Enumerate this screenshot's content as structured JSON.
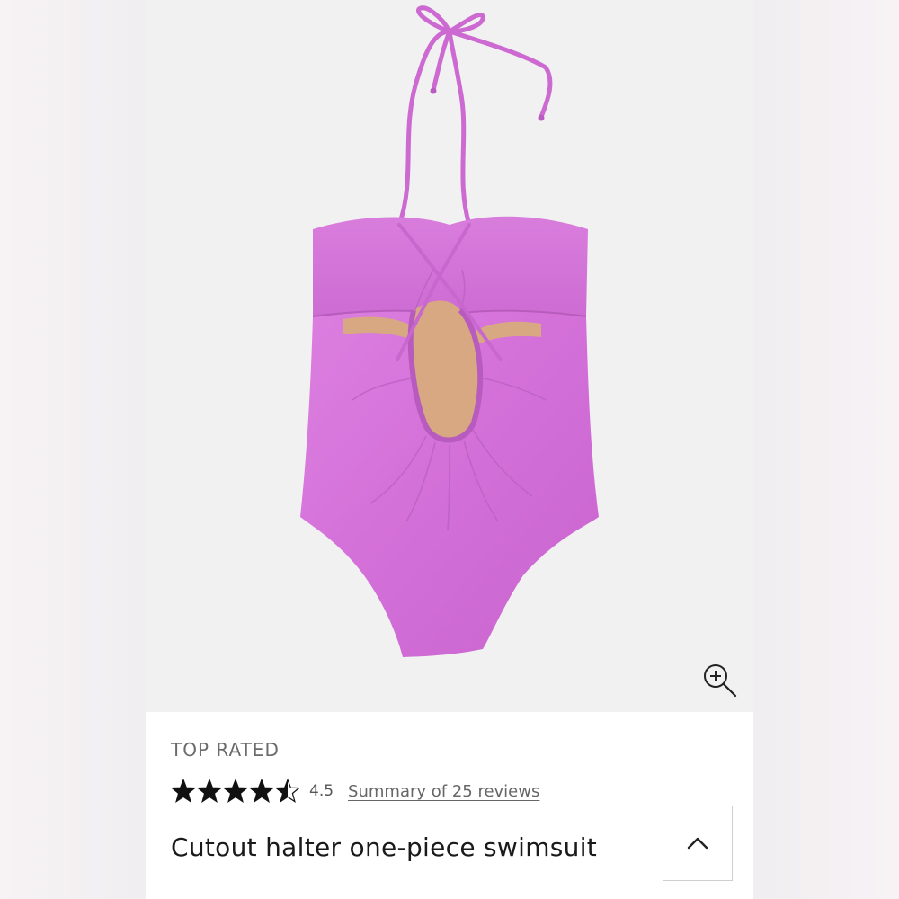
{
  "product": {
    "badge": "TOP RATED",
    "rating_value": "4.5",
    "rating_stars": 4.5,
    "rating_max": 5,
    "reviews_link": "Summary of 25 reviews",
    "title": "Cutout halter one-piece swimsuit"
  },
  "icons": {
    "zoom": "zoom-in-icon",
    "collapse": "chevron-up-icon",
    "star": "star-icon"
  },
  "colors": {
    "swimsuit": "#d36fd8",
    "lining": "#d8a882",
    "star": "#111111",
    "photo_background": "#f1f1f1"
  }
}
